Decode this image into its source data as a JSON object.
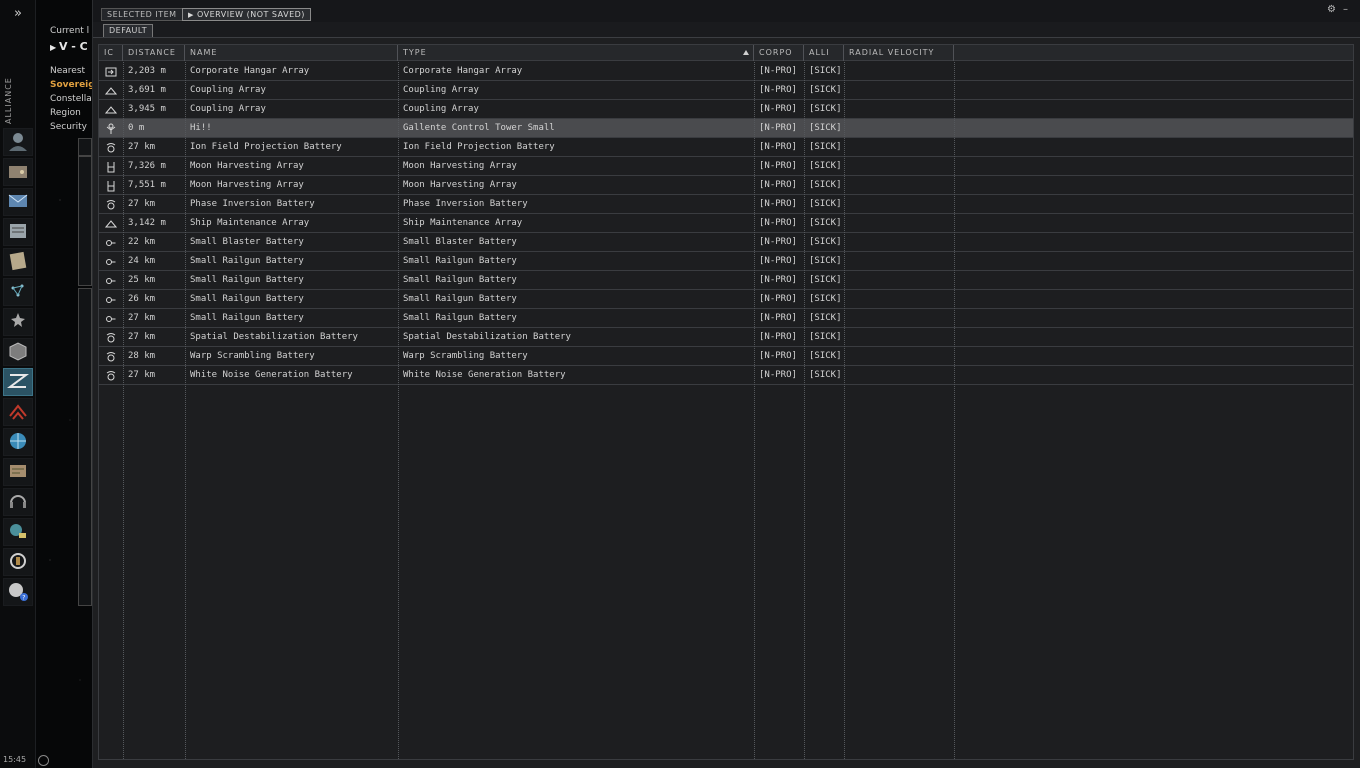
{
  "neocom": {
    "expand_label": "»",
    "alliance_label": "ALLIANCE",
    "clock": "15:45",
    "buttons": [
      {
        "icon": "character-icon"
      },
      {
        "icon": "wallet-icon"
      },
      {
        "icon": "mail-icon"
      },
      {
        "icon": "corporation-icon"
      },
      {
        "icon": "notepad-icon"
      },
      {
        "icon": "map-icon"
      },
      {
        "icon": "starmap-icon"
      },
      {
        "icon": "assets-icon"
      },
      {
        "icon": "planetary-icon"
      },
      {
        "icon": "fleet-icon"
      },
      {
        "icon": "browser-icon"
      },
      {
        "icon": "market-icon"
      },
      {
        "icon": "audio-icon"
      },
      {
        "icon": "science-icon"
      },
      {
        "icon": "settings-icon"
      },
      {
        "icon": "help-icon"
      }
    ]
  },
  "location": {
    "current_label": "Current l",
    "system": "V - C",
    "nearest": "Nearest",
    "sovereignty": "Sovereig",
    "constellation": "Constellat",
    "region": "Region",
    "security": "Security"
  },
  "window": {
    "tab_selected_item": "SELECTED ITEM",
    "tab_overview": "OVERVIEW (NOT SAVED)",
    "subtab_default": "DEFAULT",
    "options_icon": "⚙",
    "minimize_icon": "–"
  },
  "columns": [
    {
      "key": "icon",
      "label": "IC"
    },
    {
      "key": "distance",
      "label": "DISTANCE"
    },
    {
      "key": "name",
      "label": "NAME"
    },
    {
      "key": "type",
      "label": "TYPE"
    },
    {
      "key": "corp",
      "label": "CORPO"
    },
    {
      "key": "alliance",
      "label": "ALLI"
    },
    {
      "key": "radial",
      "label": "RADIAL VELOCITY"
    }
  ],
  "rows": [
    {
      "icon": "hangar-icon",
      "distance": "2,203 m",
      "name": "Corporate Hangar Array",
      "type": "Corporate Hangar Array",
      "corp": "[N-PRO]",
      "alliance": "[SICK]",
      "radial": "",
      "selected": false
    },
    {
      "icon": "structure-icon",
      "distance": "3,691 m",
      "name": "Coupling Array",
      "type": "Coupling Array",
      "corp": "[N-PRO]",
      "alliance": "[SICK]",
      "radial": "",
      "selected": false
    },
    {
      "icon": "structure-icon",
      "distance": "3,945 m",
      "name": "Coupling Array",
      "type": "Coupling Array",
      "corp": "[N-PRO]",
      "alliance": "[SICK]",
      "radial": "",
      "selected": false
    },
    {
      "icon": "control-tower-icon",
      "distance": "0 m",
      "name": "Hi!!",
      "type": "Gallente Control Tower Small",
      "corp": "[N-PRO]",
      "alliance": "[SICK]",
      "radial": "",
      "selected": true
    },
    {
      "icon": "ewar-battery-icon",
      "distance": "27 km",
      "name": "Ion Field Projection Battery",
      "type": "Ion Field Projection Battery",
      "corp": "[N-PRO]",
      "alliance": "[SICK]",
      "radial": "",
      "selected": false
    },
    {
      "icon": "moon-harvester-icon",
      "distance": "7,326 m",
      "name": "Moon Harvesting Array",
      "type": "Moon Harvesting Array",
      "corp": "[N-PRO]",
      "alliance": "[SICK]",
      "radial": "",
      "selected": false
    },
    {
      "icon": "moon-harvester-icon",
      "distance": "7,551 m",
      "name": "Moon Harvesting Array",
      "type": "Moon Harvesting Array",
      "corp": "[N-PRO]",
      "alliance": "[SICK]",
      "radial": "",
      "selected": false
    },
    {
      "icon": "ewar-battery-icon",
      "distance": "27 km",
      "name": "Phase Inversion Battery",
      "type": "Phase Inversion Battery",
      "corp": "[N-PRO]",
      "alliance": "[SICK]",
      "radial": "",
      "selected": false
    },
    {
      "icon": "structure-icon",
      "distance": "3,142 m",
      "name": "Ship Maintenance Array",
      "type": "Ship Maintenance Array",
      "corp": "[N-PRO]",
      "alliance": "[SICK]",
      "radial": "",
      "selected": false
    },
    {
      "icon": "turret-icon",
      "distance": "22 km",
      "name": "Small Blaster Battery",
      "type": "Small Blaster Battery",
      "corp": "[N-PRO]",
      "alliance": "[SICK]",
      "radial": "",
      "selected": false
    },
    {
      "icon": "turret-icon",
      "distance": "24 km",
      "name": "Small Railgun Battery",
      "type": "Small Railgun Battery",
      "corp": "[N-PRO]",
      "alliance": "[SICK]",
      "radial": "",
      "selected": false
    },
    {
      "icon": "turret-icon",
      "distance": "25 km",
      "name": "Small Railgun Battery",
      "type": "Small Railgun Battery",
      "corp": "[N-PRO]",
      "alliance": "[SICK]",
      "radial": "",
      "selected": false
    },
    {
      "icon": "turret-icon",
      "distance": "26 km",
      "name": "Small Railgun Battery",
      "type": "Small Railgun Battery",
      "corp": "[N-PRO]",
      "alliance": "[SICK]",
      "radial": "",
      "selected": false
    },
    {
      "icon": "turret-icon",
      "distance": "27 km",
      "name": "Small Railgun Battery",
      "type": "Small Railgun Battery",
      "corp": "[N-PRO]",
      "alliance": "[SICK]",
      "radial": "",
      "selected": false
    },
    {
      "icon": "ewar-battery-icon",
      "distance": "27 km",
      "name": "Spatial Destabilization Battery",
      "type": "Spatial Destabilization Battery",
      "corp": "[N-PRO]",
      "alliance": "[SICK]",
      "radial": "",
      "selected": false
    },
    {
      "icon": "ewar-battery-icon",
      "distance": "28 km",
      "name": "Warp Scrambling Battery",
      "type": "Warp Scrambling Battery",
      "corp": "[N-PRO]",
      "alliance": "[SICK]",
      "radial": "",
      "selected": false
    },
    {
      "icon": "ewar-battery-icon",
      "distance": "27 km",
      "name": "White Noise Generation Battery",
      "type": "White Noise Generation Battery",
      "corp": "[N-PRO]",
      "alliance": "[SICK]",
      "radial": "",
      "selected": false
    }
  ]
}
